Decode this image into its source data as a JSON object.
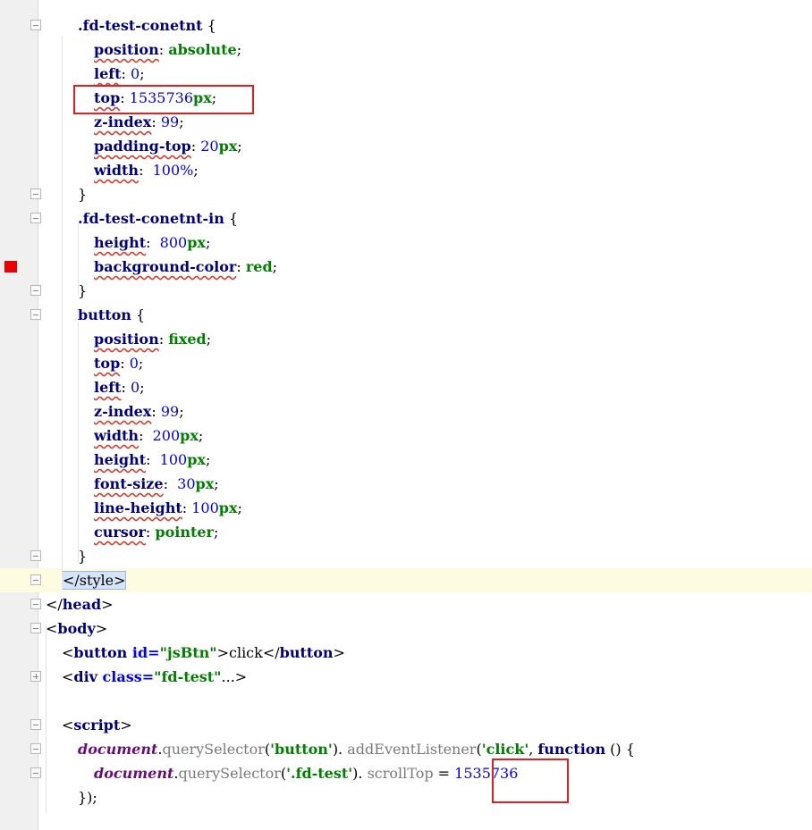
{
  "editor": {
    "lines": [
      {
        "parts": [
          [
            "sel",
            ".fd-test-conetnt"
          ],
          [
            "punc",
            " {"
          ]
        ]
      },
      {
        "parts": [
          [
            "prop",
            "position"
          ],
          [
            "punc",
            ": "
          ],
          [
            "val",
            "absolute"
          ],
          [
            "punc",
            ";"
          ]
        ]
      },
      {
        "parts": [
          [
            "prop",
            "left"
          ],
          [
            "punc",
            ": "
          ],
          [
            "num",
            "0"
          ],
          [
            "punc",
            ";"
          ]
        ]
      },
      {
        "parts": [
          [
            "prop",
            "top"
          ],
          [
            "punc",
            ": "
          ],
          [
            "num",
            "1535736"
          ],
          [
            "unit",
            "px"
          ],
          [
            "punc",
            ";"
          ]
        ]
      },
      {
        "parts": [
          [
            "prop",
            "z-index"
          ],
          [
            "punc",
            ": "
          ],
          [
            "num",
            "99"
          ],
          [
            "punc",
            ";"
          ]
        ]
      },
      {
        "parts": [
          [
            "prop",
            "padding-top"
          ],
          [
            "punc",
            ": "
          ],
          [
            "num",
            "20"
          ],
          [
            "unit",
            "px"
          ],
          [
            "punc",
            ";"
          ]
        ]
      },
      {
        "parts": [
          [
            "prop",
            "width"
          ],
          [
            "punc",
            ":  "
          ],
          [
            "num",
            "100%"
          ],
          [
            "punc",
            ";"
          ]
        ]
      },
      {
        "parts": [
          [
            "punc",
            "}"
          ]
        ]
      },
      {
        "parts": [
          [
            "sel",
            ".fd-test-conetnt-in"
          ],
          [
            "punc",
            " {"
          ]
        ]
      },
      {
        "parts": [
          [
            "prop",
            "height"
          ],
          [
            "punc",
            ":  "
          ],
          [
            "num",
            "800"
          ],
          [
            "unit",
            "px"
          ],
          [
            "punc",
            ";"
          ]
        ]
      },
      {
        "parts": [
          [
            "prop",
            "background-color"
          ],
          [
            "punc",
            ": "
          ],
          [
            "val",
            "red"
          ],
          [
            "punc",
            ";"
          ]
        ]
      },
      {
        "parts": [
          [
            "punc",
            "}"
          ]
        ]
      },
      {
        "parts": [
          [
            "sel",
            "button"
          ],
          [
            "punc",
            " {"
          ]
        ]
      },
      {
        "parts": [
          [
            "prop",
            "position"
          ],
          [
            "punc",
            ": "
          ],
          [
            "val",
            "fixed"
          ],
          [
            "punc",
            ";"
          ]
        ]
      },
      {
        "parts": [
          [
            "prop",
            "top"
          ],
          [
            "punc",
            ": "
          ],
          [
            "num",
            "0"
          ],
          [
            "punc",
            ";"
          ]
        ]
      },
      {
        "parts": [
          [
            "prop",
            "left"
          ],
          [
            "punc",
            ": "
          ],
          [
            "num",
            "0"
          ],
          [
            "punc",
            ";"
          ]
        ]
      },
      {
        "parts": [
          [
            "prop",
            "z-index"
          ],
          [
            "punc",
            ": "
          ],
          [
            "num",
            "99"
          ],
          [
            "punc",
            ";"
          ]
        ]
      },
      {
        "parts": [
          [
            "prop",
            "width"
          ],
          [
            "punc",
            ":  "
          ],
          [
            "num",
            "200"
          ],
          [
            "unit",
            "px"
          ],
          [
            "punc",
            ";"
          ]
        ]
      },
      {
        "parts": [
          [
            "prop",
            "height"
          ],
          [
            "punc",
            ":  "
          ],
          [
            "num",
            "100"
          ],
          [
            "unit",
            "px"
          ],
          [
            "punc",
            ";"
          ]
        ]
      },
      {
        "parts": [
          [
            "prop",
            "font-size"
          ],
          [
            "punc",
            ":  "
          ],
          [
            "num",
            "30"
          ],
          [
            "unit",
            "px"
          ],
          [
            "punc",
            ";"
          ]
        ]
      },
      {
        "parts": [
          [
            "prop",
            "line-height"
          ],
          [
            "punc",
            ": "
          ],
          [
            "num",
            "100"
          ],
          [
            "unit",
            "px"
          ],
          [
            "punc",
            ";"
          ]
        ]
      },
      {
        "parts": [
          [
            "prop",
            "cursor"
          ],
          [
            "punc",
            ": "
          ],
          [
            "val",
            "pointer"
          ],
          [
            "punc",
            ";"
          ]
        ]
      },
      {
        "parts": [
          [
            "punc",
            "}"
          ]
        ]
      },
      {
        "parts": [
          [
            "caret",
            "</style>"
          ]
        ]
      },
      {
        "parts": [
          [
            "tagtxt",
            "</"
          ],
          [
            "tag",
            "head"
          ],
          [
            "tagtxt",
            ">"
          ]
        ]
      },
      {
        "parts": [
          [
            "tagtxt",
            "<"
          ],
          [
            "tag",
            "body"
          ],
          [
            "tagtxt",
            ">"
          ]
        ]
      },
      {
        "parts": [
          [
            "tagtxt",
            "<"
          ],
          [
            "tag",
            "button "
          ],
          [
            "attr",
            "id="
          ],
          [
            "str",
            "\"jsBtn\""
          ],
          [
            "tagtxt",
            ">click</"
          ],
          [
            "tag",
            "button"
          ],
          [
            "tagtxt",
            ">"
          ]
        ]
      },
      {
        "parts": [
          [
            "tagtxt",
            "<"
          ],
          [
            "tag",
            "div "
          ],
          [
            "attr",
            "class="
          ],
          [
            "str",
            "\"fd-test\""
          ],
          [
            "tagtxt",
            "...>"
          ]
        ]
      },
      {
        "parts": []
      },
      {
        "parts": [
          [
            "tagtxt",
            "<"
          ],
          [
            "tag",
            "script"
          ],
          [
            "tagtxt",
            ">"
          ]
        ]
      },
      {
        "parts": [
          [
            "jsobj",
            "document"
          ],
          [
            "punc",
            "."
          ],
          [
            "jsfn",
            "querySelector"
          ],
          [
            "punc",
            "("
          ],
          [
            "jsstr",
            "'button'"
          ],
          [
            "punc",
            "). "
          ],
          [
            "jsfn",
            "addEventListener"
          ],
          [
            "punc",
            "("
          ],
          [
            "jsstr",
            "'click'"
          ],
          [
            "punc",
            ", "
          ],
          [
            "kw",
            "function"
          ],
          [
            "punc",
            " () {"
          ]
        ]
      },
      {
        "parts": [
          [
            "jsobj",
            "document"
          ],
          [
            "punc",
            "."
          ],
          [
            "jsfn",
            "querySelector"
          ],
          [
            "punc",
            "("
          ],
          [
            "jsstr",
            "'.fd-test'"
          ],
          [
            "punc",
            "). "
          ],
          [
            "jsfn",
            "scrollTop"
          ],
          [
            "punc",
            " = "
          ],
          [
            "num",
            "1535736"
          ]
        ]
      },
      {
        "parts": [
          [
            "punc",
            "});"
          ]
        ]
      }
    ]
  }
}
